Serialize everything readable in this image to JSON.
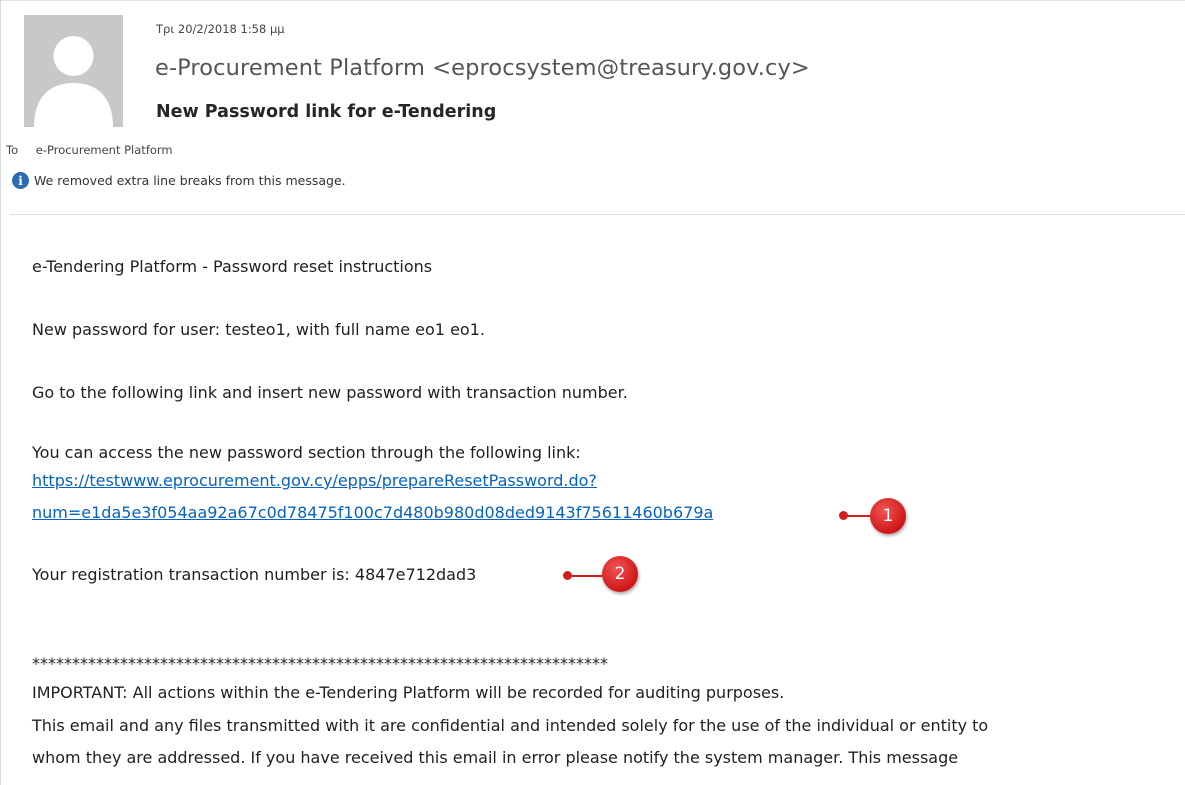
{
  "header": {
    "date": "Τρι 20/2/2018 1:58 μμ",
    "sender": "e-Procurement Platform <eprocsystem@treasury.gov.cy>",
    "subject": "New Password link for e-Tendering",
    "to_label": "To",
    "to_value": "e-Procurement Platform",
    "info_notice": "We removed extra line breaks from this message.",
    "info_icon": "info-icon"
  },
  "body": {
    "title": "e-Tendering  Platform - Password reset instructions",
    "user_line": "New password for user: testeo1, with full name eo1 eo1.",
    "instruction": "Go to the following link and insert new password with transaction number.",
    "access_text": "You can access the new password section through the following link:",
    "link_line1": "https://testwww.eprocurement.gov.cy/epps/prepareResetPassword.do?",
    "link_line2": "num=e1da5e3f054aa92a67c0d78475f100c7d480b980d08ded9143f75611460b679a",
    "transaction_text": "Your registration transaction number is: 4847e712dad3",
    "separator": "************************************************************************",
    "important": "IMPORTANT: All actions within the e-Tendering  Platform will be recorded for auditing purposes.",
    "disclaimer_line1": "This email and any files transmitted with it are confidential and intended solely for the use of the individual or entity to",
    "disclaimer_line2": "whom they are addressed. If you have received this email in error please notify the system manager. This message"
  },
  "callouts": {
    "one": "1",
    "two": "2"
  },
  "colors": {
    "link": "#0563c1",
    "callout": "#d11f1f",
    "info": "#2b6cb0"
  }
}
